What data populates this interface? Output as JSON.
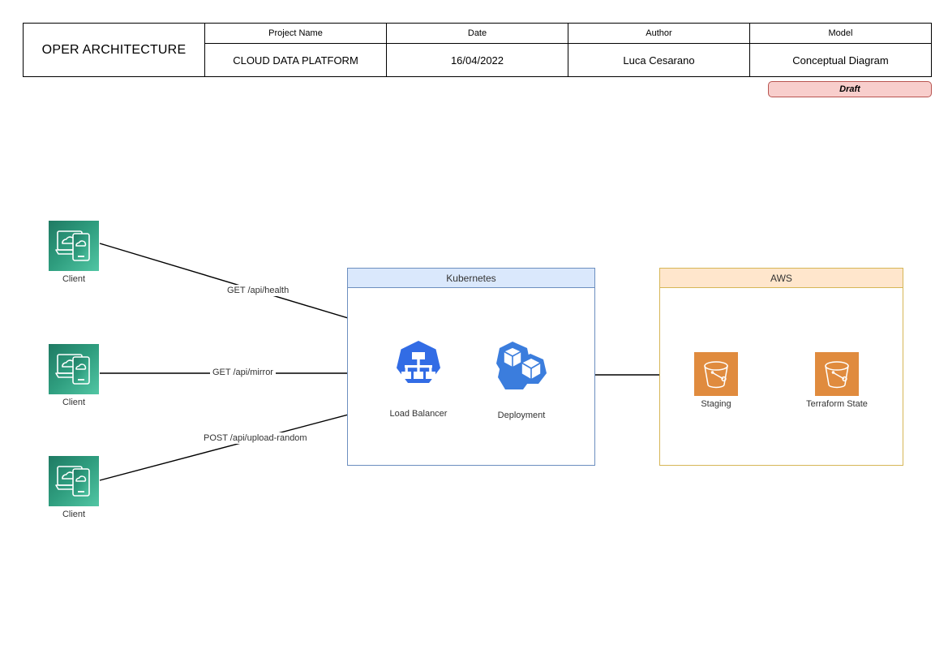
{
  "title_block": {
    "doc_title": "OPER ARCHITECTURE",
    "columns": [
      {
        "header": "Project Name",
        "value": "CLOUD DATA PLATFORM"
      },
      {
        "header": "Date",
        "value": "16/04/2022"
      },
      {
        "header": "Author",
        "value": "Luca Cesarano"
      },
      {
        "header": "Model",
        "value": "Conceptual Diagram"
      }
    ]
  },
  "status_badge": {
    "label": "Draft",
    "fill_color": "#f8cecc",
    "border_color": "#b85450"
  },
  "clients": [
    {
      "label": "Client",
      "icon": "client-laptop-phone-cloud-icon"
    },
    {
      "label": "Client",
      "icon": "client-laptop-phone-cloud-icon"
    },
    {
      "label": "Client",
      "icon": "client-laptop-phone-cloud-icon"
    }
  ],
  "groups": {
    "kubernetes": {
      "title": "Kubernetes",
      "header_color": "#dae8fc",
      "border_color": "#6c8ebf",
      "nodes": [
        {
          "label": "Load Balancer",
          "icon": "kubernetes-service-icon"
        },
        {
          "label": "Deployment",
          "icon": "kubernetes-deployment-icon"
        }
      ]
    },
    "aws": {
      "title": "AWS",
      "header_color": "#ffe6cc",
      "border_color": "#d6b656",
      "nodes": [
        {
          "label": "Staging",
          "icon": "s3-bucket-icon"
        },
        {
          "label": "Terraform State",
          "icon": "s3-bucket-icon"
        }
      ]
    }
  },
  "connections": [
    {
      "from": "Client 1",
      "to": "Load Balancer",
      "label": "GET /api/health"
    },
    {
      "from": "Client 2",
      "to": "Load Balancer",
      "label": "GET /api/mirror"
    },
    {
      "from": "Client 3",
      "to": "Load Balancer",
      "label": "POST /api/upload-random"
    },
    {
      "from": "Load Balancer",
      "to": "Deployment",
      "label": ""
    },
    {
      "from": "Deployment",
      "to": "Staging",
      "label": ""
    }
  ],
  "colors": {
    "client_green_dark": "#1f7a63",
    "client_green_light": "#4fc3a1",
    "kubernetes_blue": "#326ce5",
    "aws_orange": "#e08b3e",
    "connector": "#000000"
  }
}
